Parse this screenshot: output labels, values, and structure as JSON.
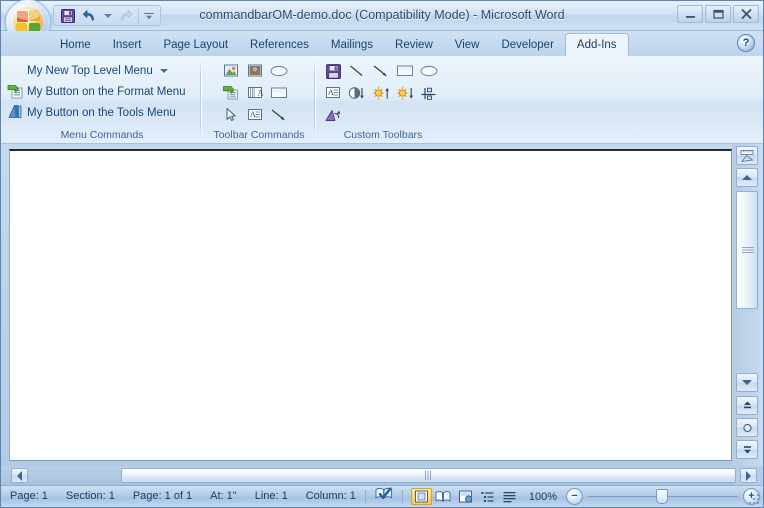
{
  "window": {
    "title": "commandbarOM-demo.doc (Compatibility Mode) - Microsoft Word",
    "office_button": "office-orb",
    "minimize_label": "–",
    "maximize_label": "❐",
    "close_label": "✕"
  },
  "quick_access": {
    "items": [
      {
        "name": "save-icon",
        "label": "Save"
      },
      {
        "name": "undo-icon",
        "label": "Undo"
      },
      {
        "name": "undo-dropdown-icon",
        "label": "Undo options"
      },
      {
        "name": "redo-icon",
        "label": "Redo"
      },
      {
        "name": "customize-qat-icon",
        "label": "Customize Quick Access Toolbar"
      }
    ]
  },
  "tabs": [
    {
      "label": "Home",
      "active": false
    },
    {
      "label": "Insert",
      "active": false
    },
    {
      "label": "Page Layout",
      "active": false
    },
    {
      "label": "References",
      "active": false
    },
    {
      "label": "Mailings",
      "active": false
    },
    {
      "label": "Review",
      "active": false
    },
    {
      "label": "View",
      "active": false
    },
    {
      "label": "Developer",
      "active": false
    },
    {
      "label": "Add-Ins",
      "active": true
    }
  ],
  "help": {
    "label": "?"
  },
  "ribbon": {
    "groups": [
      {
        "name": "menu-commands",
        "label": "Menu Commands",
        "rows": [
          {
            "icon": "none",
            "text": "My New Top Level Menu",
            "dropdown": true
          },
          {
            "icon": "format-menu-icon",
            "text": "My Button on the Format Menu",
            "dropdown": false
          },
          {
            "icon": "tools-menu-icon",
            "text": "My Button on the Tools Menu",
            "dropdown": false
          }
        ]
      },
      {
        "name": "toolbar-commands",
        "label": "Toolbar Commands",
        "icons": [
          "insert-picture-icon",
          "insert-clip-art-icon",
          "oval-shape-icon",
          "insert-wordart-icon",
          "insert-table-text-icon",
          "rectangle-shape-icon",
          "select-arrow-icon",
          "text-box-icon",
          "line-arrow-icon"
        ]
      },
      {
        "name": "custom-toolbars",
        "label": "Custom Toolbars",
        "icons": [
          "save-icon",
          "line-icon",
          "arrow-icon",
          "rectangle-icon",
          "oval-icon",
          "text-box-icon",
          "contrast-decrease-icon",
          "brightness-increase-icon",
          "brightness-decrease-icon",
          "align-distribute-icon",
          "rotate-icon"
        ]
      }
    ]
  },
  "document": {
    "content": ""
  },
  "scroll": {
    "ruler_toggle": "view-ruler-icon",
    "up_arrow": "scroll-up-icon",
    "down_arrow": "scroll-down-icon",
    "previous_page": "previous-page-icon",
    "select_browse_object": "select-browse-object-icon",
    "next_page": "next-page-icon",
    "left_arrow": "scroll-left-icon",
    "right_arrow": "scroll-right-icon"
  },
  "status": {
    "page": "Page: 1",
    "section": "Section: 1",
    "page_of": "Page: 1 of 1",
    "at": "At: 1\"",
    "line": "Line: 1",
    "column": "Column: 1",
    "proofing_icon": "spelling-check-icon",
    "views": [
      {
        "name": "print-layout-view",
        "active": true
      },
      {
        "name": "full-screen-reading-view",
        "active": false
      },
      {
        "name": "web-layout-view",
        "active": false
      },
      {
        "name": "outline-view",
        "active": false
      },
      {
        "name": "draft-view",
        "active": false
      }
    ],
    "zoom_level": "100%",
    "zoom_out_label": "−",
    "zoom_in_label": "+"
  },
  "colors": {
    "accent": "#ffd36a",
    "ribbon_text": "#15477e",
    "group_label": "#3f6592",
    "title_text": "#2c4a6b"
  }
}
